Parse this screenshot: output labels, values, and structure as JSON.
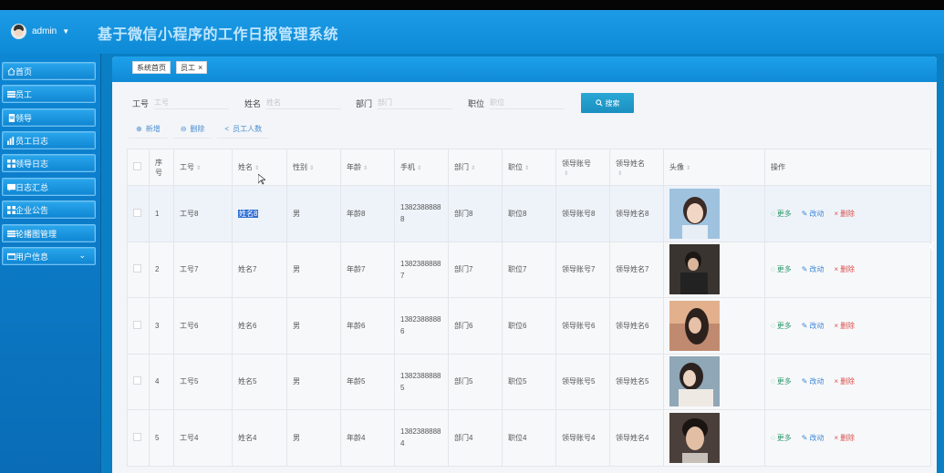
{
  "header": {
    "user": "admin",
    "title": "基于微信小程序的工作日报管理系统"
  },
  "sidebar": {
    "items": [
      {
        "label": "首页",
        "icon": "home-icon"
      },
      {
        "label": "员工",
        "icon": "list-icon"
      },
      {
        "label": "领导",
        "icon": "doc-icon"
      },
      {
        "label": "员工日志",
        "icon": "bar-chart-icon"
      },
      {
        "label": "领导日志",
        "icon": "grid-icon"
      },
      {
        "label": "日志汇总",
        "icon": "message-icon"
      },
      {
        "label": "企业公告",
        "icon": "grid-icon"
      },
      {
        "label": "轮播图管理",
        "icon": "list-icon"
      },
      {
        "label": "用户信息",
        "icon": "window-icon"
      }
    ]
  },
  "tabs": {
    "home": "系统首页",
    "current": "员工"
  },
  "search": {
    "fields": [
      {
        "label": "工号",
        "placeholder": "工号"
      },
      {
        "label": "姓名",
        "placeholder": "姓名"
      },
      {
        "label": "部门",
        "placeholder": "部门"
      },
      {
        "label": "职位",
        "placeholder": "职位"
      }
    ],
    "button": "搜索"
  },
  "actions": {
    "add": "新增",
    "delete": "删除",
    "count": "员工人数"
  },
  "table": {
    "headers": [
      "序号",
      "工号",
      "姓名",
      "性别",
      "年龄",
      "手机",
      "部门",
      "职位",
      "领导账号",
      "领导姓名",
      "头像",
      "操作"
    ],
    "rows": [
      {
        "idx": "1",
        "no": "工号8",
        "name": "姓名8",
        "sex": "男",
        "age": "年龄8",
        "phone": "13823888888",
        "dept": "部门8",
        "pos": "职位8",
        "lacc": "领导账号8",
        "lname": "领导姓名8"
      },
      {
        "idx": "2",
        "no": "工号7",
        "name": "姓名7",
        "sex": "男",
        "age": "年龄7",
        "phone": "13823888887",
        "dept": "部门7",
        "pos": "职位7",
        "lacc": "领导账号7",
        "lname": "领导姓名7"
      },
      {
        "idx": "3",
        "no": "工号6",
        "name": "姓名6",
        "sex": "男",
        "age": "年龄6",
        "phone": "13823888886",
        "dept": "部门6",
        "pos": "职位6",
        "lacc": "领导账号6",
        "lname": "领导姓名6"
      },
      {
        "idx": "4",
        "no": "工号5",
        "name": "姓名5",
        "sex": "男",
        "age": "年龄5",
        "phone": "13823888885",
        "dept": "部门5",
        "pos": "职位5",
        "lacc": "领导账号5",
        "lname": "领导姓名5"
      },
      {
        "idx": "5",
        "no": "工号4",
        "name": "姓名4",
        "sex": "男",
        "age": "年龄4",
        "phone": "13823888884",
        "dept": "部门4",
        "pos": "职位4",
        "lacc": "领导账号4",
        "lname": "领导姓名4"
      }
    ],
    "ops": {
      "more": "更多",
      "edit": "改动",
      "delete": "删除"
    }
  },
  "colors": {
    "header": "#0d8ad6",
    "title": "#bfe6ff",
    "accent": "#1a8fc0",
    "more": "#2e9a6b",
    "edit": "#3d86d4",
    "delete": "#d9534f"
  }
}
